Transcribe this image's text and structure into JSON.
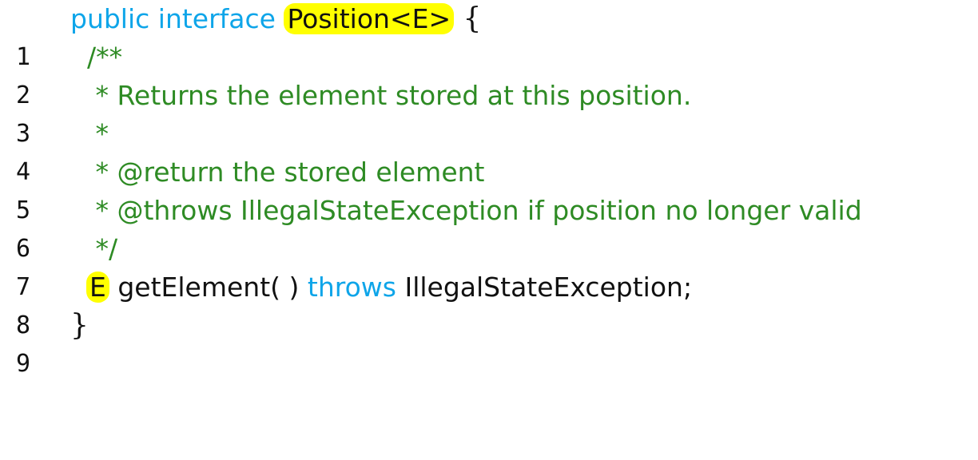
{
  "code_lines": [
    {
      "number": "1",
      "kw1": "public interface ",
      "highlight": "Position<E>",
      "brace": " {"
    },
    {
      "number": "2",
      "comment": "  /**"
    },
    {
      "number": "3",
      "comment": "   * Returns the element stored at this position."
    },
    {
      "number": "4",
      "comment": "   *"
    },
    {
      "number": "5",
      "comment": "   * @return the stored element"
    },
    {
      "number": "6",
      "comment": "   * @throws IllegalStateException if position no longer valid"
    },
    {
      "number": "7",
      "comment": "   */"
    },
    {
      "number": "8",
      "highlight": "E",
      "text1": " getElement( ) ",
      "kw1": "throws",
      "text2": " IllegalStateException;"
    },
    {
      "number": "9",
      "brace": "}"
    }
  ],
  "colors": {
    "keyword": "#0ea5e9",
    "comment": "#2e8b24",
    "highlight": "#ffff00",
    "text": "#111111"
  }
}
